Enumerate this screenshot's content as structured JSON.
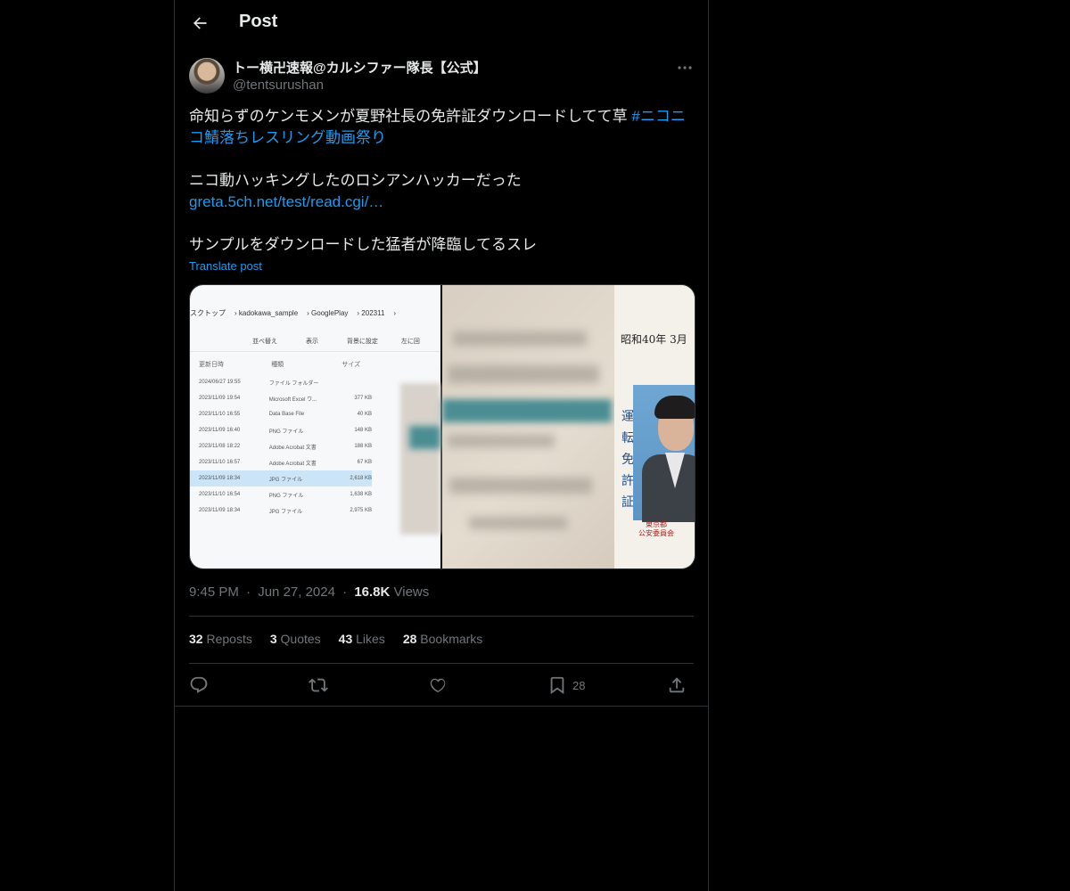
{
  "header": {
    "title": "Post"
  },
  "post": {
    "author_name": "トー横卍速報@カルシファー隊長【公式】",
    "handle": "@tentsurushan",
    "line1": "命知らずのケンモメンが夏野社長の免許証ダウンロードしてて草 ",
    "hashtag": "#ニコニコ鯖落ちレスリング動画祭り",
    "line2": "ニコ動ハッキングしたのロシアンハッカーだった",
    "link": "greta.5ch.net/test/read.cgi/…",
    "line3": "サンプルをダウンロードした猛者が降臨してるスレ",
    "translate_label": "Translate post"
  },
  "media": {
    "explorer": {
      "breadcrumb": [
        "スクトップ",
        "kadokawa_sample",
        "GooglePlay",
        "202311"
      ],
      "toolbar": [
        "並べ替え",
        "表示",
        "背景に設定",
        "左に回"
      ],
      "headers": [
        "更新日時",
        "種類",
        "サイズ"
      ],
      "rows": [
        {
          "date": "2024/06/27 19:55",
          "type": "ファイル フォルダー",
          "size": ""
        },
        {
          "date": "2023/11/09 19:54",
          "type": "Microsoft Excel ワ...",
          "size": "377 KB"
        },
        {
          "date": "2023/11/10 16:55",
          "type": "Data Base File",
          "size": "40 KB"
        },
        {
          "date": "2023/11/09 16:40",
          "type": "PNG ファイル",
          "size": "148 KB"
        },
        {
          "date": "2023/11/08 18:22",
          "type": "Adobe Acrobat 文書",
          "size": "188 KB"
        },
        {
          "date": "2023/11/10 16:57",
          "type": "Adobe Acrobat 文書",
          "size": "67 KB"
        },
        {
          "date": "2023/11/09 18:34",
          "type": "JPG ファイル",
          "size": "2,618 KB"
        },
        {
          "date": "2023/11/10 16:54",
          "type": "PNG ファイル",
          "size": "1,638 KB"
        },
        {
          "date": "2023/11/09 18:34",
          "type": "JPG ファイル",
          "size": "2,975 KB"
        }
      ]
    },
    "license": {
      "date": "昭和40年 3月",
      "vertical_label": [
        "運",
        "転",
        "免",
        "許",
        "証"
      ],
      "authority_line1": "東京都",
      "authority_line2": "公安委員会"
    }
  },
  "meta": {
    "time": "9:45 PM",
    "separator": "·",
    "date": "Jun 27, 2024",
    "views_count": "16.8K",
    "views_label": "Views"
  },
  "stats": {
    "reposts_count": "32",
    "reposts_label": "Reposts",
    "quotes_count": "3",
    "quotes_label": "Quotes",
    "likes_count": "43",
    "likes_label": "Likes",
    "bookmarks_count": "28",
    "bookmarks_label": "Bookmarks"
  },
  "actions": {
    "bookmark_count": "28"
  },
  "colors": {
    "background": "#000000",
    "text": "#e7e9ea",
    "muted": "#71767b",
    "link": "#1d9bf0",
    "border": "#2f3336"
  }
}
